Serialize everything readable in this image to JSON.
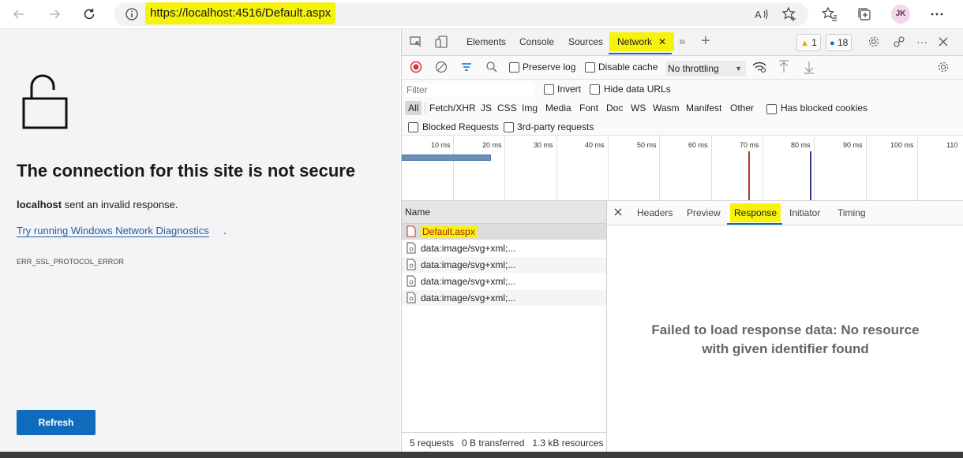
{
  "browser": {
    "url": "https://localhost:4516/Default.aspx",
    "avatar_initials": "JK"
  },
  "error_page": {
    "title": "The connection for this site is not secure",
    "host": "localhost",
    "description": " sent an invalid response.",
    "diagnostics_link": "Try running Windows Network Diagnostics",
    "diagnostics_link_suffix": ".",
    "error_code": "ERR_SSL_PROTOCOL_ERROR",
    "refresh_label": "Refresh"
  },
  "devtools": {
    "tabs": [
      "Elements",
      "Console",
      "Sources",
      "Network"
    ],
    "warnings_count": "1",
    "messages_count": "18",
    "preserve_log": "Preserve log",
    "disable_cache": "Disable cache",
    "throttling": "No throttling",
    "filter_placeholder": "Filter",
    "invert": "Invert",
    "hide_data_urls": "Hide data URLs",
    "types": [
      "All",
      "Fetch/XHR",
      "JS",
      "CSS",
      "Img",
      "Media",
      "Font",
      "Doc",
      "WS",
      "Wasm",
      "Manifest",
      "Other"
    ],
    "has_blocked_cookies": "Has blocked cookies",
    "blocked_requests": "Blocked Requests",
    "third_party": "3rd-party requests",
    "timeline_ticks": [
      "10 ms",
      "20 ms",
      "30 ms",
      "40 ms",
      "50 ms",
      "60 ms",
      "70 ms",
      "80 ms",
      "90 ms",
      "100 ms",
      "110"
    ],
    "name_header": "Name",
    "requests": [
      {
        "name": "Default.aspx",
        "status": "error"
      },
      {
        "name": "data:image/svg+xml;...",
        "status": "ok"
      },
      {
        "name": "data:image/svg+xml;...",
        "status": "ok"
      },
      {
        "name": "data:image/svg+xml;...",
        "status": "ok"
      },
      {
        "name": "data:image/svg+xml;...",
        "status": "ok"
      }
    ],
    "summary": "5 requests   0 B transferred   1.3 kB resources",
    "detail_tabs": [
      "Headers",
      "Preview",
      "Response",
      "Initiator",
      "Timing"
    ],
    "response_message": "Failed to load response data: No resource with given identifier found"
  },
  "colors": {
    "highlight": "#f7f20a",
    "accent": "#0f6cbd",
    "error_red": "#d13438"
  }
}
